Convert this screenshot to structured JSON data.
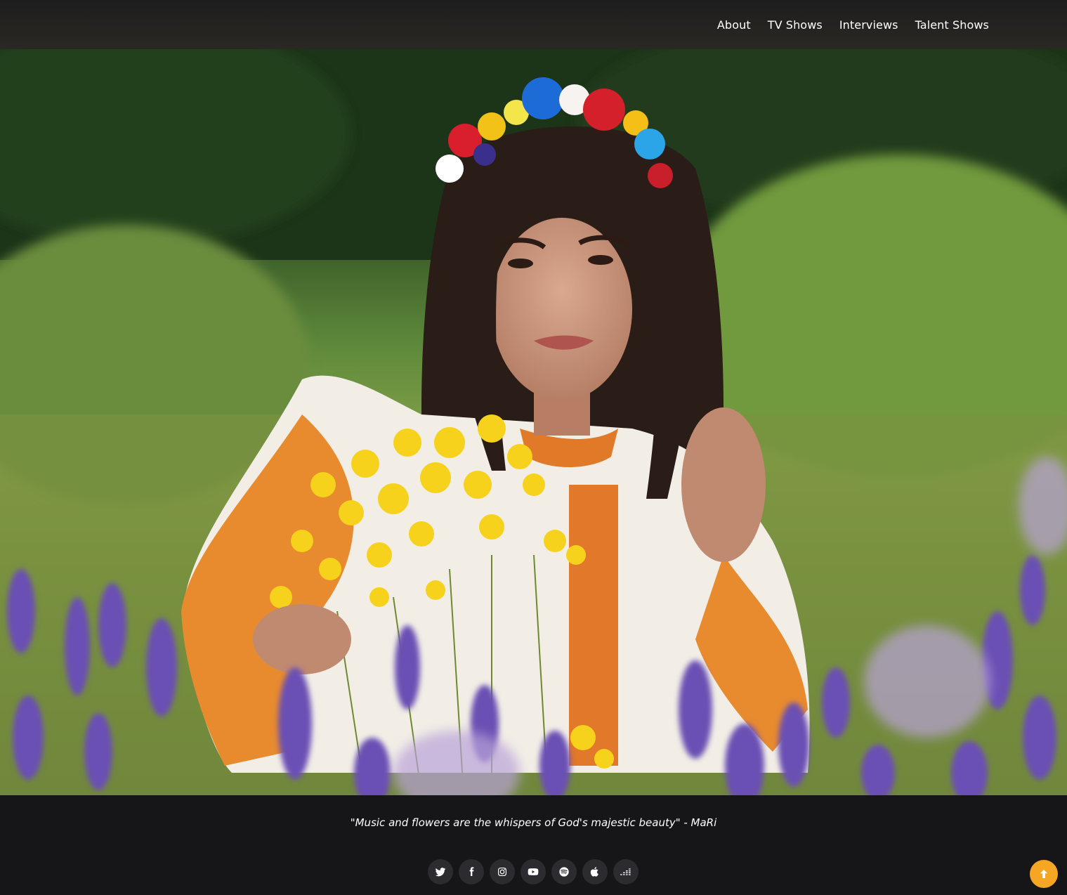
{
  "nav": {
    "items": [
      {
        "label": "About"
      },
      {
        "label": "TV Shows"
      },
      {
        "label": "Interviews"
      },
      {
        "label": "Talent Shows"
      }
    ]
  },
  "hero": {
    "image_alt": "Girl with flower crown in a field holding yellow flowers"
  },
  "footer": {
    "quote": "\"Music and flowers are the whispers of God's majestic beauty\" - MaRi",
    "social": [
      {
        "icon": "twitter-icon"
      },
      {
        "icon": "facebook-icon"
      },
      {
        "icon": "instagram-icon"
      },
      {
        "icon": "youtube-icon"
      },
      {
        "icon": "spotify-icon"
      },
      {
        "icon": "apple-icon"
      },
      {
        "icon": "deezer-icon"
      }
    ]
  },
  "colors": {
    "accent": "#f5a623",
    "footer_bg": "#161619",
    "social_bg": "#2c2c30"
  }
}
